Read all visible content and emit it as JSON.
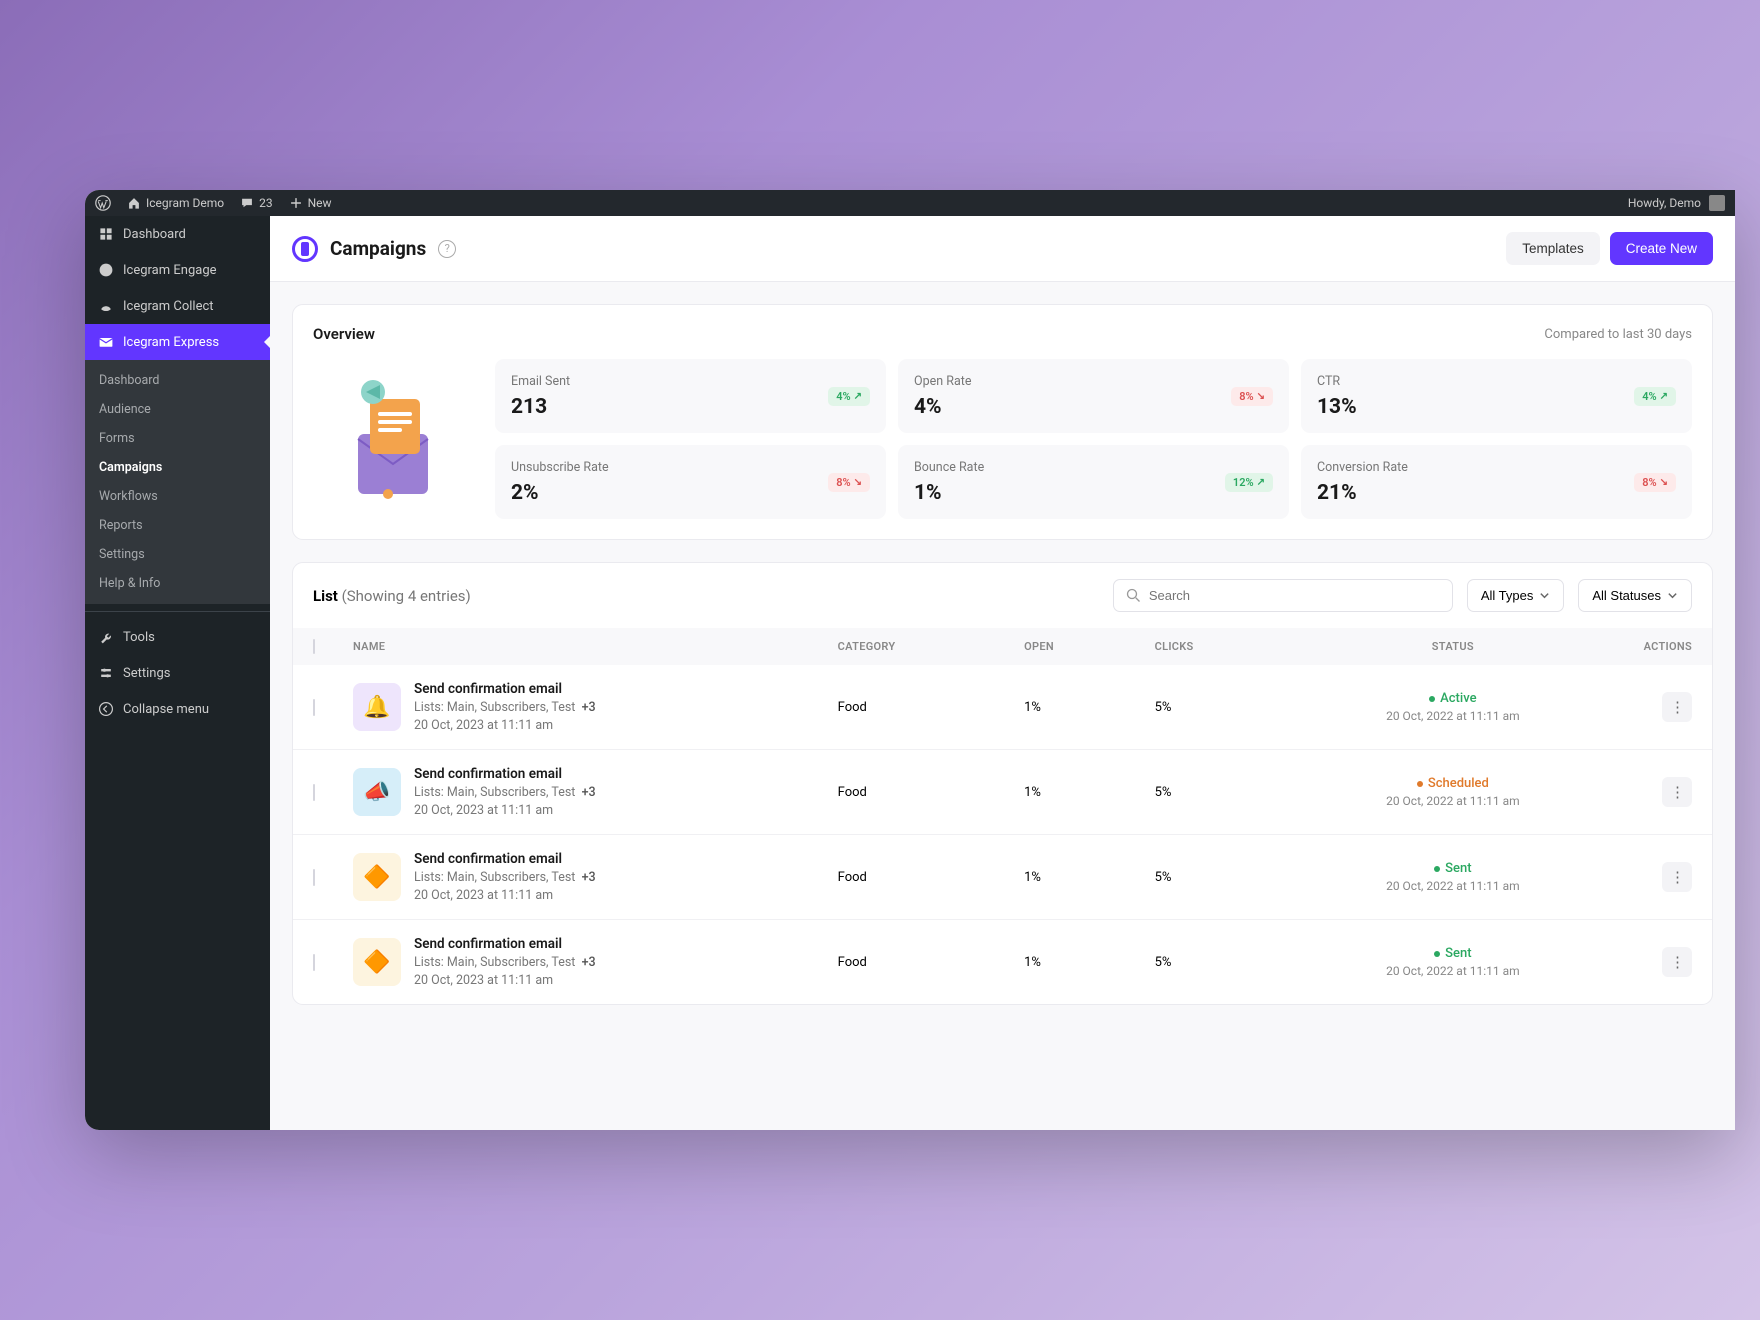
{
  "adminBar": {
    "siteName": "Icegram Demo",
    "comments": "23",
    "newLabel": "New",
    "greeting": "Howdy, Demo"
  },
  "sidebar": {
    "top": [
      {
        "label": "Dashboard",
        "icon": "dash"
      },
      {
        "label": "Icegram Engage",
        "icon": "engage"
      },
      {
        "label": "Icegram Collect",
        "icon": "collect"
      },
      {
        "label": "Icegram Express",
        "icon": "express",
        "active": true
      }
    ],
    "sub": [
      {
        "label": "Dashboard"
      },
      {
        "label": "Audience"
      },
      {
        "label": "Forms"
      },
      {
        "label": "Campaigns",
        "active": true
      },
      {
        "label": "Workflows"
      },
      {
        "label": "Reports"
      },
      {
        "label": "Settings"
      },
      {
        "label": "Help & Info"
      }
    ],
    "bottom": [
      {
        "label": "Tools",
        "icon": "tools"
      },
      {
        "label": "Settings",
        "icon": "settings"
      },
      {
        "label": "Collapse menu",
        "icon": "collapse"
      }
    ]
  },
  "header": {
    "title": "Campaigns",
    "helpGlyph": "?",
    "templatesBtn": "Templates",
    "createBtn": "Create New"
  },
  "overview": {
    "title": "Overview",
    "compare": "Compared to last 30 days",
    "metrics": [
      {
        "label": "Email Sent",
        "value": "213",
        "trend": "4%",
        "dir": "up"
      },
      {
        "label": "Open Rate",
        "value": "4%",
        "trend": "8%",
        "dir": "down"
      },
      {
        "label": "CTR",
        "value": "13%",
        "trend": "4%",
        "dir": "up"
      },
      {
        "label": "Unsubscribe Rate",
        "value": "2%",
        "trend": "8%",
        "dir": "down"
      },
      {
        "label": "Bounce Rate",
        "value": "1%",
        "trend": "12%",
        "dir": "up"
      },
      {
        "label": "Conversion Rate",
        "value": "21%",
        "trend": "8%",
        "dir": "down"
      }
    ]
  },
  "list": {
    "title": "List",
    "subtitle": "(Showing 4 entries)",
    "searchPlaceholder": "Search",
    "filterType": "All Types",
    "filterStatus": "All Statuses",
    "columns": {
      "name": "NAME",
      "category": "CATEGORY",
      "open": "OPEN",
      "clicks": "CLICKS",
      "status": "STATUS",
      "actions": "ACTIONS"
    },
    "rows": [
      {
        "thumbClass": "thumb-purple",
        "thumbGlyph": "🔔",
        "name": "Send confirmation email",
        "lists": "Lists: Main, Subscribers, Test",
        "extra": "+3",
        "date": "20 Oct, 2023 at 11:11 am",
        "category": "Food",
        "open": "1%",
        "clicks": "5%",
        "status": "Active",
        "statusClass": "status-active",
        "statusDate": "20 Oct, 2022 at 11:11 am"
      },
      {
        "thumbClass": "thumb-blue",
        "thumbGlyph": "📣",
        "name": "Send confirmation email",
        "lists": "Lists: Main, Subscribers, Test",
        "extra": "+3",
        "date": "20 Oct, 2023 at 11:11 am",
        "category": "Food",
        "open": "1%",
        "clicks": "5%",
        "status": "Scheduled",
        "statusClass": "status-scheduled",
        "statusDate": "20 Oct, 2022 at 11:11 am"
      },
      {
        "thumbClass": "thumb-yellow",
        "thumbGlyph": "🔶",
        "name": "Send confirmation email",
        "lists": "Lists: Main, Subscribers, Test",
        "extra": "+3",
        "date": "20 Oct, 2023 at 11:11 am",
        "category": "Food",
        "open": "1%",
        "clicks": "5%",
        "status": "Sent",
        "statusClass": "status-sent",
        "statusDate": "20 Oct, 2022 at 11:11 am"
      },
      {
        "thumbClass": "thumb-yellow",
        "thumbGlyph": "🔶",
        "name": "Send confirmation email",
        "lists": "Lists: Main, Subscribers, Test",
        "extra": "+3",
        "date": "20 Oct, 2023 at 11:11 am",
        "category": "Food",
        "open": "1%",
        "clicks": "5%",
        "status": "Sent",
        "statusClass": "status-sent",
        "statusDate": "20 Oct, 2022 at 11:11 am"
      }
    ]
  }
}
